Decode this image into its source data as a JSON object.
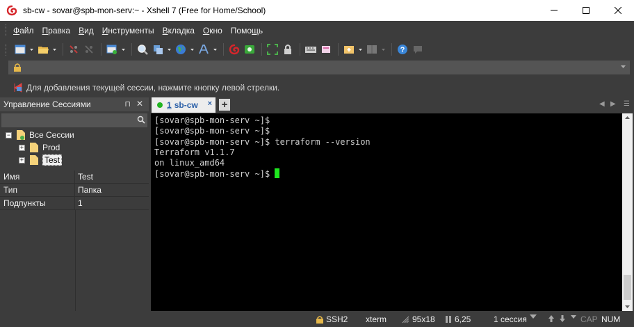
{
  "window": {
    "title": "sb-cw - sovar@spb-mon-serv:~ - Xshell 7 (Free for Home/School)"
  },
  "menu": [
    {
      "pre": "",
      "ul": "Ф",
      "post": "айл"
    },
    {
      "pre": "",
      "ul": "П",
      "post": "равка"
    },
    {
      "pre": "",
      "ul": "В",
      "post": "ид"
    },
    {
      "pre": "",
      "ul": "И",
      "post": "нструменты"
    },
    {
      "pre": "",
      "ul": "В",
      "post": "кладка"
    },
    {
      "pre": "",
      "ul": "О",
      "post": "кно"
    },
    {
      "pre": "Помо",
      "ul": "щ",
      "post": "ь"
    }
  ],
  "address": {
    "value": ""
  },
  "hint": {
    "text": "Для добавления текущей сессии, нажмите кнопку левой стрелки."
  },
  "session_panel": {
    "title": "Управление Сессиями",
    "pin_glyph": "⊓",
    "close_glyph": "✕",
    "tree": {
      "root": "Все Сессии",
      "children": [
        "Prod",
        "Test"
      ]
    },
    "properties": [
      {
        "key": "Имя",
        "value": "Test"
      },
      {
        "key": "Тип",
        "value": "Папка"
      },
      {
        "key": "Подпункты",
        "value": "1"
      }
    ]
  },
  "tabs": [
    {
      "number": "1",
      "label": "sb-cw",
      "status_color": "#22b422"
    }
  ],
  "terminal": {
    "lines": [
      "[sovar@spb-mon-serv ~]$",
      "[sovar@spb-mon-serv ~]$",
      "[sovar@spb-mon-serv ~]$ terraform --version",
      "Terraform v1.1.7",
      "on linux_amd64",
      "[sovar@spb-mon-serv ~]$ "
    ],
    "cursor_color": "#1fe61f"
  },
  "status": {
    "protocol": "SSH2",
    "terminal_type": "xterm",
    "size": "95x18",
    "cursor_pos": "6,25",
    "sessions": "1 сессия",
    "cap": "CAP",
    "num": "NUM"
  }
}
